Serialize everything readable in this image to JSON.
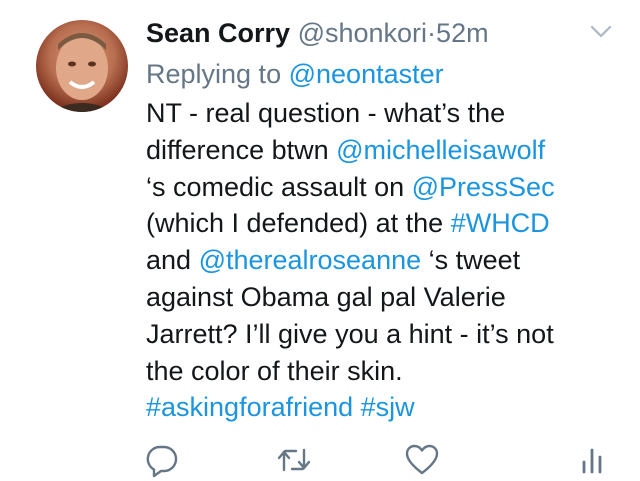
{
  "tweet": {
    "author_name": "Sean Corry",
    "author_handle": "@shonkori",
    "separator": "·",
    "timestamp": "52m",
    "replying_label": "Replying to",
    "replying_handle": "@neontaster",
    "lines": [
      [
        {
          "t": "NT - real question - what’s the",
          "link": false
        }
      ],
      [
        {
          "t": "difference btwn ",
          "link": false
        },
        {
          "t": "@michelleisawolf",
          "link": true
        }
      ],
      [
        {
          "t": "‘s comedic assault on ",
          "link": false
        },
        {
          "t": "@PressSec",
          "link": true
        }
      ],
      [
        {
          "t": "(which I defended) at the ",
          "link": false
        },
        {
          "t": "#WHCD",
          "link": true
        }
      ],
      [
        {
          "t": "and ",
          "link": false
        },
        {
          "t": "@therealroseanne",
          "link": true
        },
        {
          "t": " ‘s tweet",
          "link": false
        }
      ],
      [
        {
          "t": "against Obama gal pal Valerie",
          "link": false
        }
      ],
      [
        {
          "t": "Jarrett? I’ll give you a hint - it’s not",
          "link": false
        }
      ],
      [
        {
          "t": "the color of their skin.",
          "link": false
        }
      ],
      [
        {
          "t": "#askingforafriend",
          "link": true
        },
        {
          "t": " ",
          "link": false
        },
        {
          "t": "#sjw",
          "link": true
        }
      ]
    ]
  },
  "icons": {
    "caret": "chevron-down-icon",
    "reply": "reply-icon",
    "retweet": "retweet-icon",
    "like": "heart-icon",
    "analytics": "analytics-icon"
  },
  "colors": {
    "link": "#1b95e0",
    "secondary_text": "#657786",
    "primary_text": "#14171a"
  }
}
